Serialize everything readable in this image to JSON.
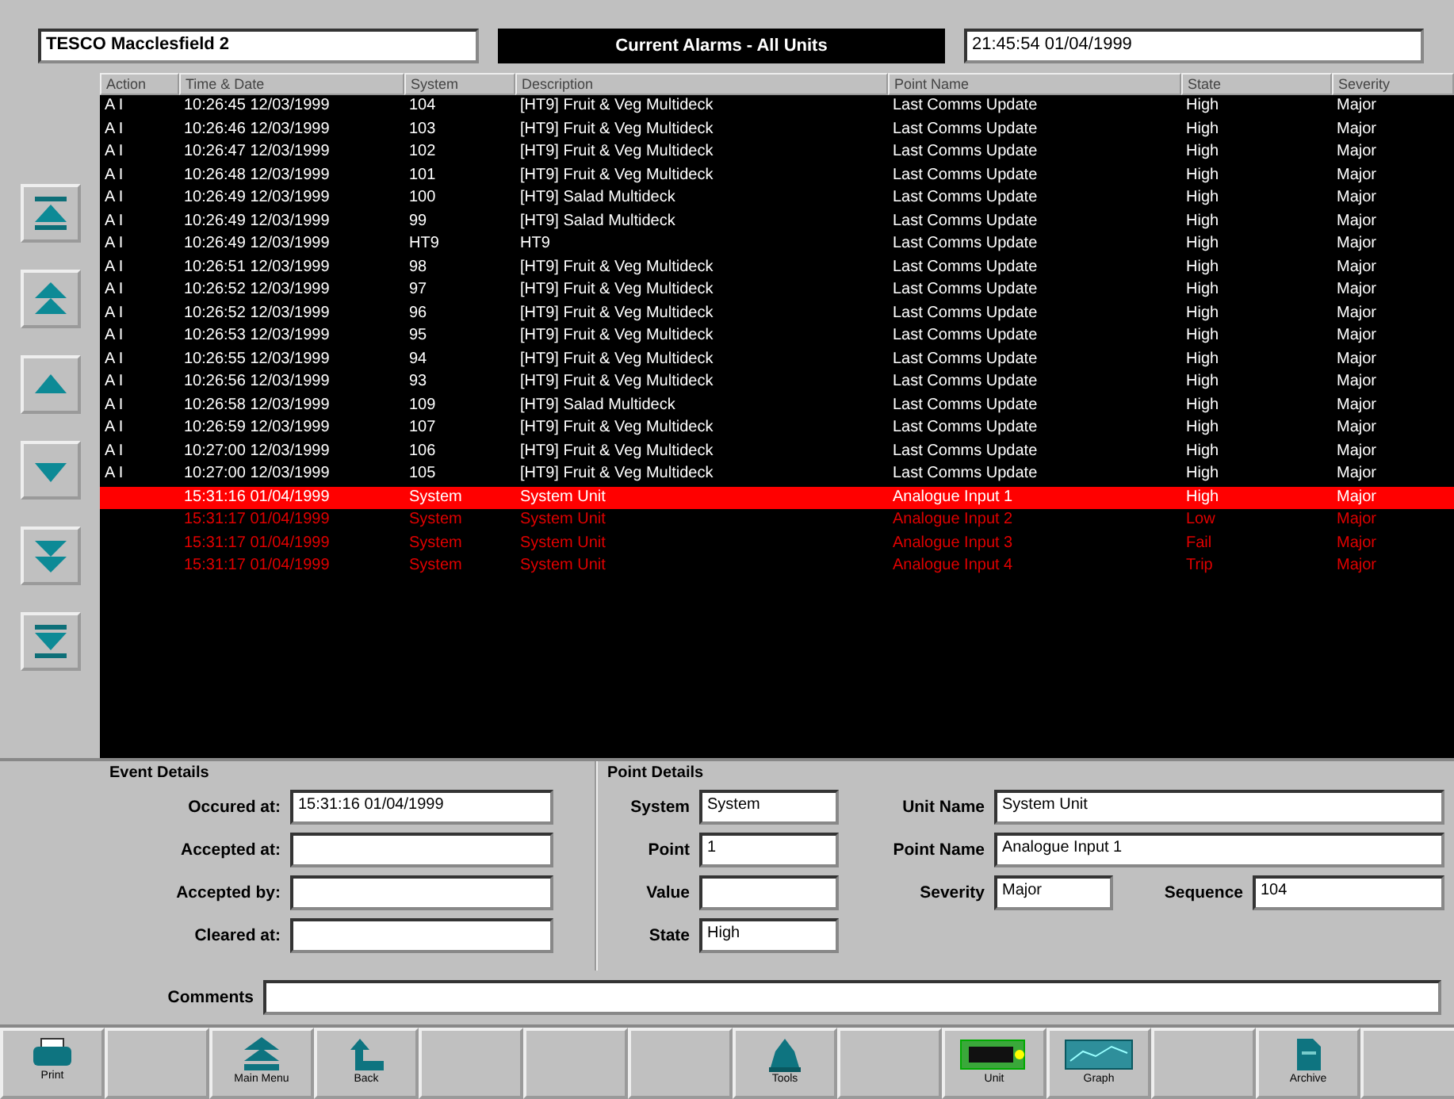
{
  "header": {
    "site": "TESCO Macclesfield 2",
    "title": "Current Alarms - All Units",
    "clock": "21:45:54 01/04/1999"
  },
  "table": {
    "columns": [
      "Action",
      "Time & Date",
      "System",
      "Description",
      "Point Name",
      "State",
      "Severity"
    ],
    "rows": [
      {
        "cells": [
          "A I",
          "10:26:45 12/03/1999",
          "104",
          "[HT9] Fruit & Veg Multideck",
          "Last Comms Update",
          "High",
          "Major"
        ],
        "kind": "accepted",
        "selected": false
      },
      {
        "cells": [
          "A I",
          "10:26:46 12/03/1999",
          "103",
          "[HT9] Fruit & Veg Multideck",
          "Last Comms Update",
          "High",
          "Major"
        ],
        "kind": "accepted",
        "selected": false
      },
      {
        "cells": [
          "A I",
          "10:26:47 12/03/1999",
          "102",
          "[HT9] Fruit & Veg Multideck",
          "Last Comms Update",
          "High",
          "Major"
        ],
        "kind": "accepted",
        "selected": false
      },
      {
        "cells": [
          "A I",
          "10:26:48 12/03/1999",
          "101",
          "[HT9] Fruit & Veg Multideck",
          "Last Comms Update",
          "High",
          "Major"
        ],
        "kind": "accepted",
        "selected": false
      },
      {
        "cells": [
          "A I",
          "10:26:49 12/03/1999",
          "100",
          "[HT9] Salad Multideck",
          "Last Comms Update",
          "High",
          "Major"
        ],
        "kind": "accepted",
        "selected": false
      },
      {
        "cells": [
          "A I",
          "10:26:49 12/03/1999",
          "99",
          "[HT9] Salad Multideck",
          "Last Comms Update",
          "High",
          "Major"
        ],
        "kind": "accepted",
        "selected": false
      },
      {
        "cells": [
          "A I",
          "10:26:49 12/03/1999",
          "HT9",
          "HT9",
          "Last Comms Update",
          "High",
          "Major"
        ],
        "kind": "accepted",
        "selected": false
      },
      {
        "cells": [
          "A I",
          "10:26:51 12/03/1999",
          "98",
          "[HT9] Fruit & Veg Multideck",
          "Last Comms Update",
          "High",
          "Major"
        ],
        "kind": "accepted",
        "selected": false
      },
      {
        "cells": [
          "A I",
          "10:26:52 12/03/1999",
          "97",
          "[HT9] Fruit & Veg Multideck",
          "Last Comms Update",
          "High",
          "Major"
        ],
        "kind": "accepted",
        "selected": false
      },
      {
        "cells": [
          "A I",
          "10:26:52 12/03/1999",
          "96",
          "[HT9] Fruit & Veg Multideck",
          "Last Comms Update",
          "High",
          "Major"
        ],
        "kind": "accepted",
        "selected": false
      },
      {
        "cells": [
          "A I",
          "10:26:53 12/03/1999",
          "95",
          "[HT9] Fruit & Veg Multideck",
          "Last Comms Update",
          "High",
          "Major"
        ],
        "kind": "accepted",
        "selected": false
      },
      {
        "cells": [
          "A I",
          "10:26:55 12/03/1999",
          "94",
          "[HT9] Fruit & Veg Multideck",
          "Last Comms Update",
          "High",
          "Major"
        ],
        "kind": "accepted",
        "selected": false
      },
      {
        "cells": [
          "A I",
          "10:26:56 12/03/1999",
          "93",
          "[HT9] Fruit & Veg Multideck",
          "Last Comms Update",
          "High",
          "Major"
        ],
        "kind": "accepted",
        "selected": false
      },
      {
        "cells": [
          "A I",
          "10:26:58 12/03/1999",
          "109",
          "[HT9] Salad Multideck",
          "Last Comms Update",
          "High",
          "Major"
        ],
        "kind": "accepted",
        "selected": false
      },
      {
        "cells": [
          "A I",
          "10:26:59 12/03/1999",
          "107",
          "[HT9] Fruit & Veg Multideck",
          "Last Comms Update",
          "High",
          "Major"
        ],
        "kind": "accepted",
        "selected": false
      },
      {
        "cells": [
          "A I",
          "10:27:00 12/03/1999",
          "106",
          "[HT9] Fruit & Veg Multideck",
          "Last Comms Update",
          "High",
          "Major"
        ],
        "kind": "accepted",
        "selected": false
      },
      {
        "cells": [
          "A I",
          "10:27:00 12/03/1999",
          "105",
          "[HT9] Fruit & Veg Multideck",
          "Last Comms Update",
          "High",
          "Major"
        ],
        "kind": "accepted",
        "selected": false
      },
      {
        "cells": [
          "",
          "15:31:16 01/04/1999",
          "System",
          "System Unit",
          "Analogue Input 1",
          "High",
          "Major"
        ],
        "kind": "new",
        "selected": true
      },
      {
        "cells": [
          "",
          "15:31:17 01/04/1999",
          "System",
          "System Unit",
          "Analogue Input 2",
          "Low",
          "Major"
        ],
        "kind": "new",
        "selected": false
      },
      {
        "cells": [
          "",
          "15:31:17 01/04/1999",
          "System",
          "System Unit",
          "Analogue Input 3",
          "Fail",
          "Major"
        ],
        "kind": "new",
        "selected": false
      },
      {
        "cells": [
          "",
          "15:31:17 01/04/1999",
          "System",
          "System Unit",
          "Analogue Input 4",
          "Trip",
          "Major"
        ],
        "kind": "new",
        "selected": false
      }
    ]
  },
  "nav_buttons": [
    {
      "kind": "top"
    },
    {
      "kind": "page-up"
    },
    {
      "kind": "up"
    },
    {
      "kind": "down"
    },
    {
      "kind": "page-down"
    },
    {
      "kind": "bottom"
    }
  ],
  "event_details": {
    "title": "Event Details",
    "fields": [
      {
        "label": "Occured at:",
        "value": "15:31:16 01/04/1999"
      },
      {
        "label": "Accepted at:"
      },
      {
        "label": "Accepted by:"
      },
      {
        "label": "Cleared at:"
      }
    ]
  },
  "point_details": {
    "title": "Point Details",
    "left": [
      {
        "label": "System",
        "value": "System"
      },
      {
        "label": "Point",
        "value": "1"
      },
      {
        "label": "Value"
      },
      {
        "label": "State",
        "value": "High"
      }
    ],
    "unit_name": {
      "label": "Unit Name",
      "value": "System Unit"
    },
    "point_name": {
      "label": "Point Name",
      "value": "Analogue Input 1"
    },
    "severity": {
      "label": "Severity",
      "value": "Major"
    },
    "sequence": {
      "label": "Sequence",
      "value": "104"
    }
  },
  "comments": {
    "label": "Comments"
  },
  "toolbar": [
    {
      "kind": "printer",
      "label": "Print"
    },
    {
      "kind": "blank"
    },
    {
      "kind": "main-menu",
      "label": "Main Menu"
    },
    {
      "kind": "back",
      "label": "Back"
    },
    {
      "kind": "blank"
    },
    {
      "kind": "blank"
    },
    {
      "kind": "blank"
    },
    {
      "kind": "tools",
      "label": "Tools"
    },
    {
      "kind": "blank"
    },
    {
      "kind": "unit",
      "label": "Unit"
    },
    {
      "kind": "graph",
      "label": "Graph"
    },
    {
      "kind": "blank"
    },
    {
      "kind": "archive",
      "label": "Archive"
    },
    {
      "kind": "blank"
    }
  ]
}
